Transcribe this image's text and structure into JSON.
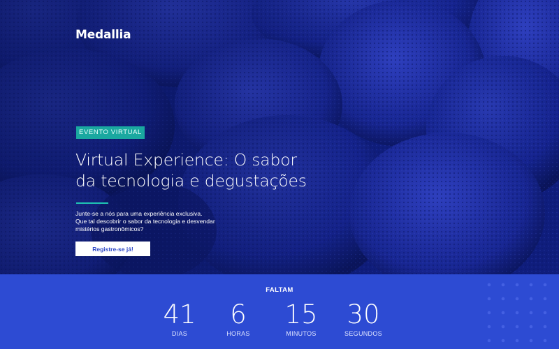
{
  "brand": {
    "logo_text": "Medallia"
  },
  "hero": {
    "tag": "EVENTO VIRTUAL",
    "title_line1": "Virtual Experience: O sabor",
    "title_line2": "da tecnologia e degustações",
    "desc_line1": "Junte-se a nós para uma experiência exclusiva.",
    "desc_line2": "Que tal descobrir o sabor da tecnologia e desvendar",
    "desc_line3": "mistérios gastronômicos?",
    "cta_label": "Registre-se já!"
  },
  "countdown": {
    "heading": "FALTAM",
    "units": [
      {
        "value": "41",
        "label": "DIAS"
      },
      {
        "value": "6",
        "label": "HORAS"
      },
      {
        "value": "15",
        "label": "MINUTOS"
      },
      {
        "value": "30",
        "label": "SEGUNDOS"
      }
    ]
  },
  "colors": {
    "accent_teal": "#1aa8a0",
    "countdown_blue": "#2d4bd3",
    "hero_navy": "#0d1c78",
    "cta_text": "#2f49c6"
  }
}
